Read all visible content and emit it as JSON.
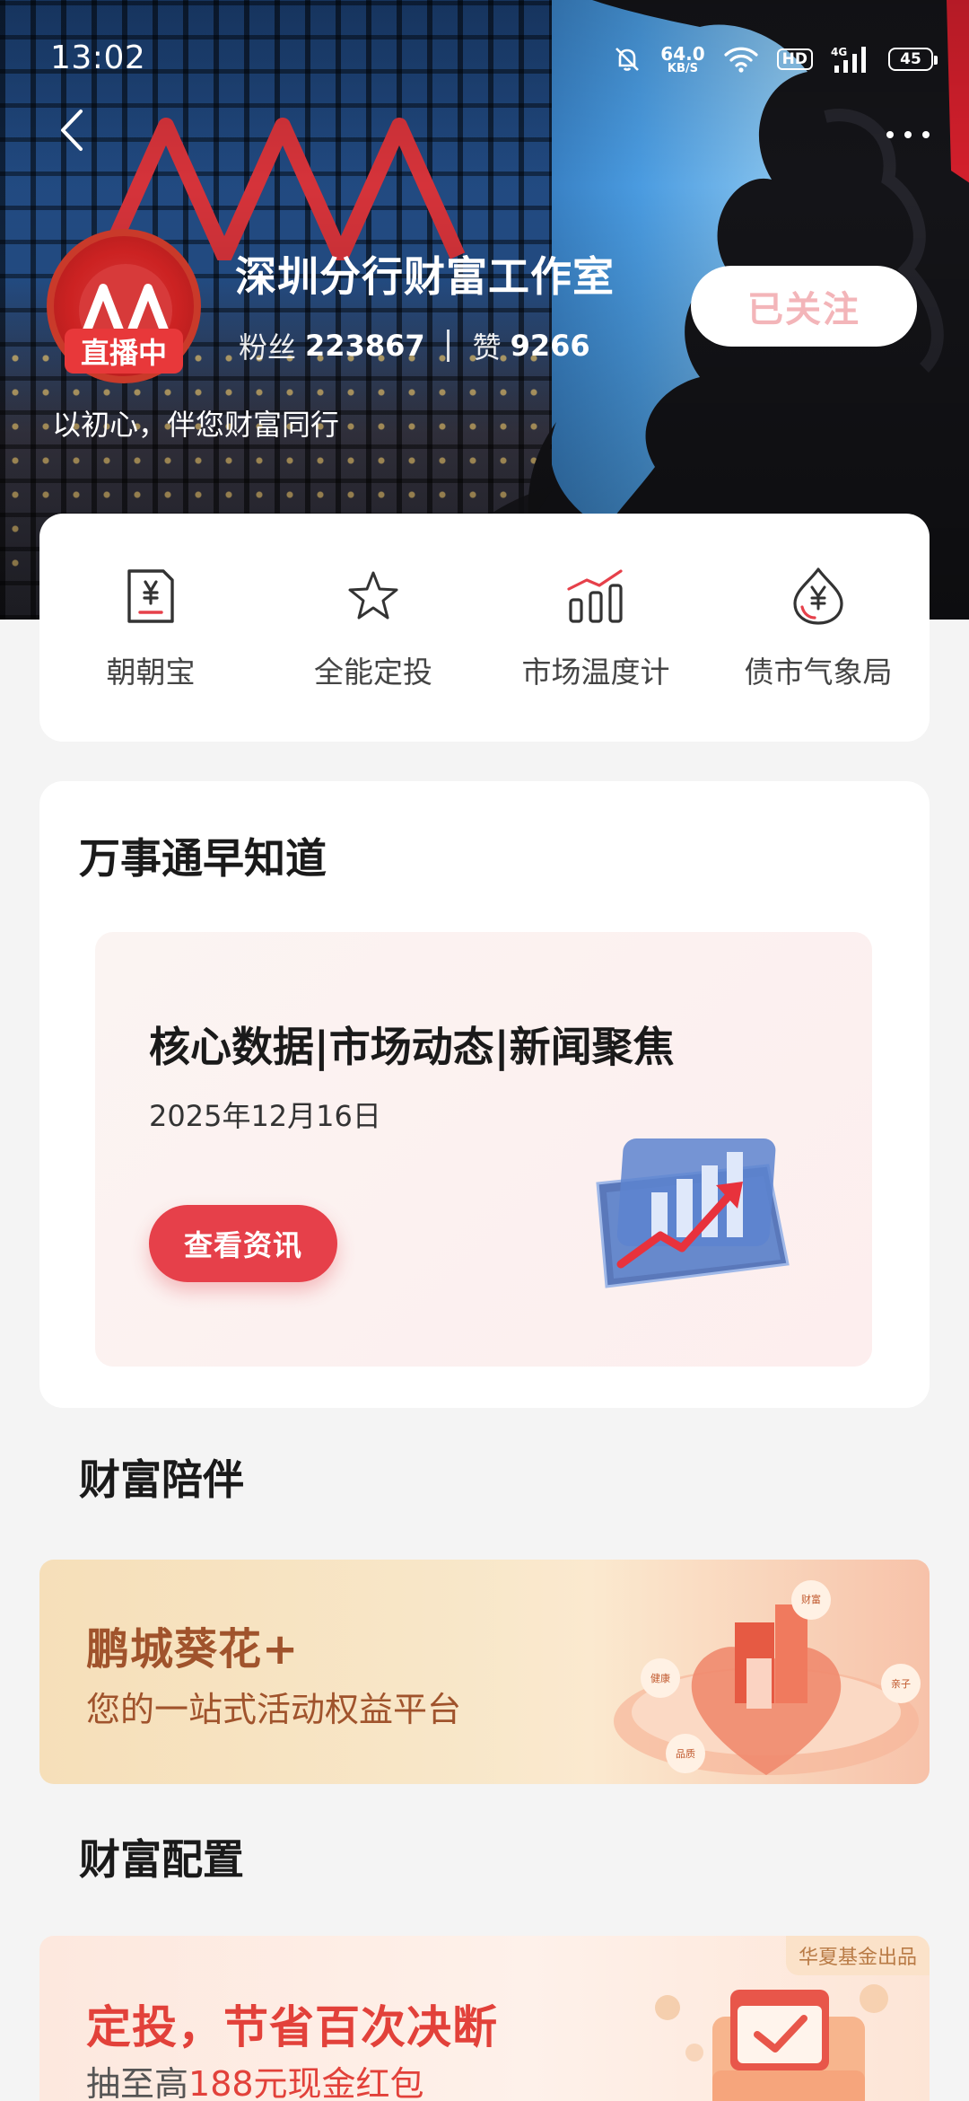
{
  "status_bar": {
    "time": "13:02",
    "net_speed_value": "64.0",
    "net_speed_unit": "KB/S",
    "hd_label": "HD",
    "network_type": "4G",
    "battery_level": "45"
  },
  "profile": {
    "live_badge": "直播中",
    "name": "深圳分行财富工作室",
    "fans_label": "粉丝",
    "fans_count": "223867",
    "likes_label": "赞",
    "likes_count": "9266",
    "follow_button": "已关注",
    "slogan": "以初心，伴您财富同行"
  },
  "quick_actions": [
    {
      "label": "朝朝宝",
      "icon": "yuan-doc-icon"
    },
    {
      "label": "全能定投",
      "icon": "star-icon"
    },
    {
      "label": "市场温度计",
      "icon": "bar-chart-icon"
    },
    {
      "label": "债市气象局",
      "icon": "yuan-drop-icon"
    }
  ],
  "news_section": {
    "title": "万事通早知道",
    "headline": "核心数据|市场动态|新闻聚焦",
    "date": "2025年12月16日",
    "button": "查看资讯"
  },
  "wealth_section": {
    "title": "财富陪伴",
    "banner_title": "鹏城葵花+",
    "banner_subtitle": "您的一站式活动权益平台",
    "art_labels": [
      "财富",
      "健康",
      "亲子",
      "品质"
    ]
  },
  "config_section": {
    "title": "财富配置",
    "banner_tag": "华夏基金出品",
    "banner_title": "定投，节省百次决断",
    "banner_subtitle_prefix": "抽至高",
    "banner_subtitle_highlight": "188元现金红包"
  },
  "colors": {
    "brand_red": "#e6404a",
    "follow_text": "#f3b5b9",
    "banner_brown": "#a0532c"
  }
}
